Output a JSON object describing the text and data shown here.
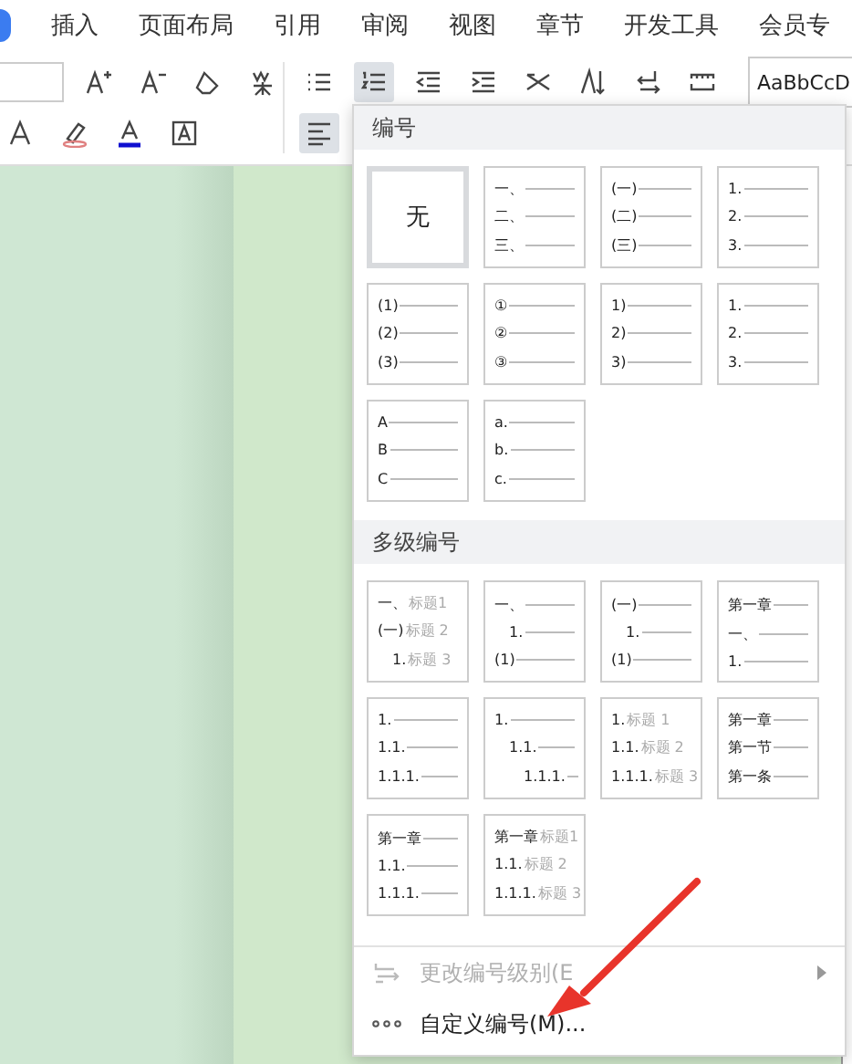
{
  "menu_tabs": [
    {
      "label": "插入",
      "selected": false
    },
    {
      "label": "页面布局",
      "selected": false
    },
    {
      "label": "引用",
      "selected": false
    },
    {
      "label": "审阅",
      "selected": false
    },
    {
      "label": "视图",
      "selected": false
    },
    {
      "label": "章节",
      "selected": false
    },
    {
      "label": "开发工具",
      "selected": false
    },
    {
      "label": "会员专",
      "selected": false
    }
  ],
  "toolbar": {
    "numbering_active": true,
    "align_left_active": true,
    "style_preview": "AaBbCcD"
  },
  "numbering_menu": {
    "sections": [
      {
        "title": "编号",
        "cells": [
          {
            "kind": "none",
            "text": "无",
            "selected": true
          },
          {
            "kind": "list",
            "selected": false,
            "lines": [
              {
                "prefix": "一、"
              },
              {
                "prefix": "二、"
              },
              {
                "prefix": "三、"
              }
            ]
          },
          {
            "kind": "list",
            "selected": false,
            "lines": [
              {
                "prefix": "(一)"
              },
              {
                "prefix": "(二)"
              },
              {
                "prefix": "(三)"
              }
            ]
          },
          {
            "kind": "list",
            "selected": false,
            "lines": [
              {
                "prefix": "1."
              },
              {
                "prefix": "2."
              },
              {
                "prefix": "3."
              }
            ]
          },
          {
            "kind": "list",
            "selected": false,
            "lines": [
              {
                "prefix": "(1)"
              },
              {
                "prefix": "(2)"
              },
              {
                "prefix": "(3)"
              }
            ]
          },
          {
            "kind": "list",
            "selected": false,
            "lines": [
              {
                "prefix": "①"
              },
              {
                "prefix": "②"
              },
              {
                "prefix": "③"
              }
            ]
          },
          {
            "kind": "list",
            "selected": false,
            "lines": [
              {
                "prefix": "1)"
              },
              {
                "prefix": "2)"
              },
              {
                "prefix": "3)"
              }
            ]
          },
          {
            "kind": "list",
            "selected": false,
            "lines": [
              {
                "prefix": "1."
              },
              {
                "prefix": "2."
              },
              {
                "prefix": "3."
              }
            ]
          },
          {
            "kind": "list",
            "selected": false,
            "lines": [
              {
                "prefix": "A"
              },
              {
                "prefix": "B"
              },
              {
                "prefix": "C"
              }
            ]
          },
          {
            "kind": "list",
            "selected": false,
            "lines": [
              {
                "prefix": "a."
              },
              {
                "prefix": "b."
              },
              {
                "prefix": "c."
              }
            ]
          }
        ]
      },
      {
        "title": "多级编号",
        "cells": [
          {
            "kind": "list",
            "selected": false,
            "lines": [
              {
                "prefix": "一、",
                "label": "标题1"
              },
              {
                "prefix": "(一)",
                "label": "标题 2",
                "children": [
                  {
                    "prefix": "1.",
                    "label": "标题 3"
                  }
                ]
              }
            ]
          },
          {
            "kind": "list",
            "selected": false,
            "lines": [
              {
                "prefix": "一、",
                "children": [
                  {
                    "prefix": "1."
                  }
                ]
              },
              {
                "prefix": "(1)"
              }
            ]
          },
          {
            "kind": "list",
            "selected": false,
            "lines": [
              {
                "prefix": "(一)",
                "children": [
                  {
                    "prefix": "1."
                  }
                ]
              },
              {
                "prefix": "(1)"
              }
            ]
          },
          {
            "kind": "list",
            "selected": false,
            "lines": [
              {
                "prefix": "第一章"
              },
              {
                "prefix": "一、"
              },
              {
                "prefix": "1."
              }
            ]
          },
          {
            "kind": "list",
            "selected": false,
            "lines": [
              {
                "prefix": "1."
              },
              {
                "prefix": "1.1."
              },
              {
                "prefix": "1.1.1."
              }
            ]
          },
          {
            "kind": "list",
            "selected": false,
            "lines": [
              {
                "prefix": "1.",
                "children": [
                  {
                    "prefix": "1.1.",
                    "children": [
                      {
                        "prefix": "1.1.1."
                      }
                    ]
                  }
                ]
              }
            ]
          },
          {
            "kind": "list",
            "selected": false,
            "lines": [
              {
                "prefix": "1.",
                "label": "标题 1"
              },
              {
                "prefix": "1.1.",
                "label": "标题 2"
              },
              {
                "prefix": "1.1.1.",
                "label": "标题 3"
              }
            ]
          },
          {
            "kind": "list",
            "selected": false,
            "lines": [
              {
                "prefix": "第一章"
              },
              {
                "prefix": "第一节"
              },
              {
                "prefix": "第一条"
              }
            ]
          },
          {
            "kind": "list",
            "selected": false,
            "lines": [
              {
                "prefix": "第一章"
              },
              {
                "prefix": "1.1."
              },
              {
                "prefix": "1.1.1."
              }
            ]
          },
          {
            "kind": "list",
            "selected": false,
            "lines": [
              {
                "prefix": "第一章",
                "label": "标题1"
              },
              {
                "prefix": "1.1.",
                "label": "标题 2"
              },
              {
                "prefix": "1.1.1.",
                "label": "标题 3"
              }
            ]
          }
        ]
      }
    ],
    "commands": [
      {
        "kind": "levels",
        "label": "更改编号级别(E",
        "disabled": true,
        "submenu": true
      },
      {
        "kind": "custom",
        "label": "自定义编号(M)...",
        "disabled": false,
        "submenu": false
      }
    ]
  }
}
